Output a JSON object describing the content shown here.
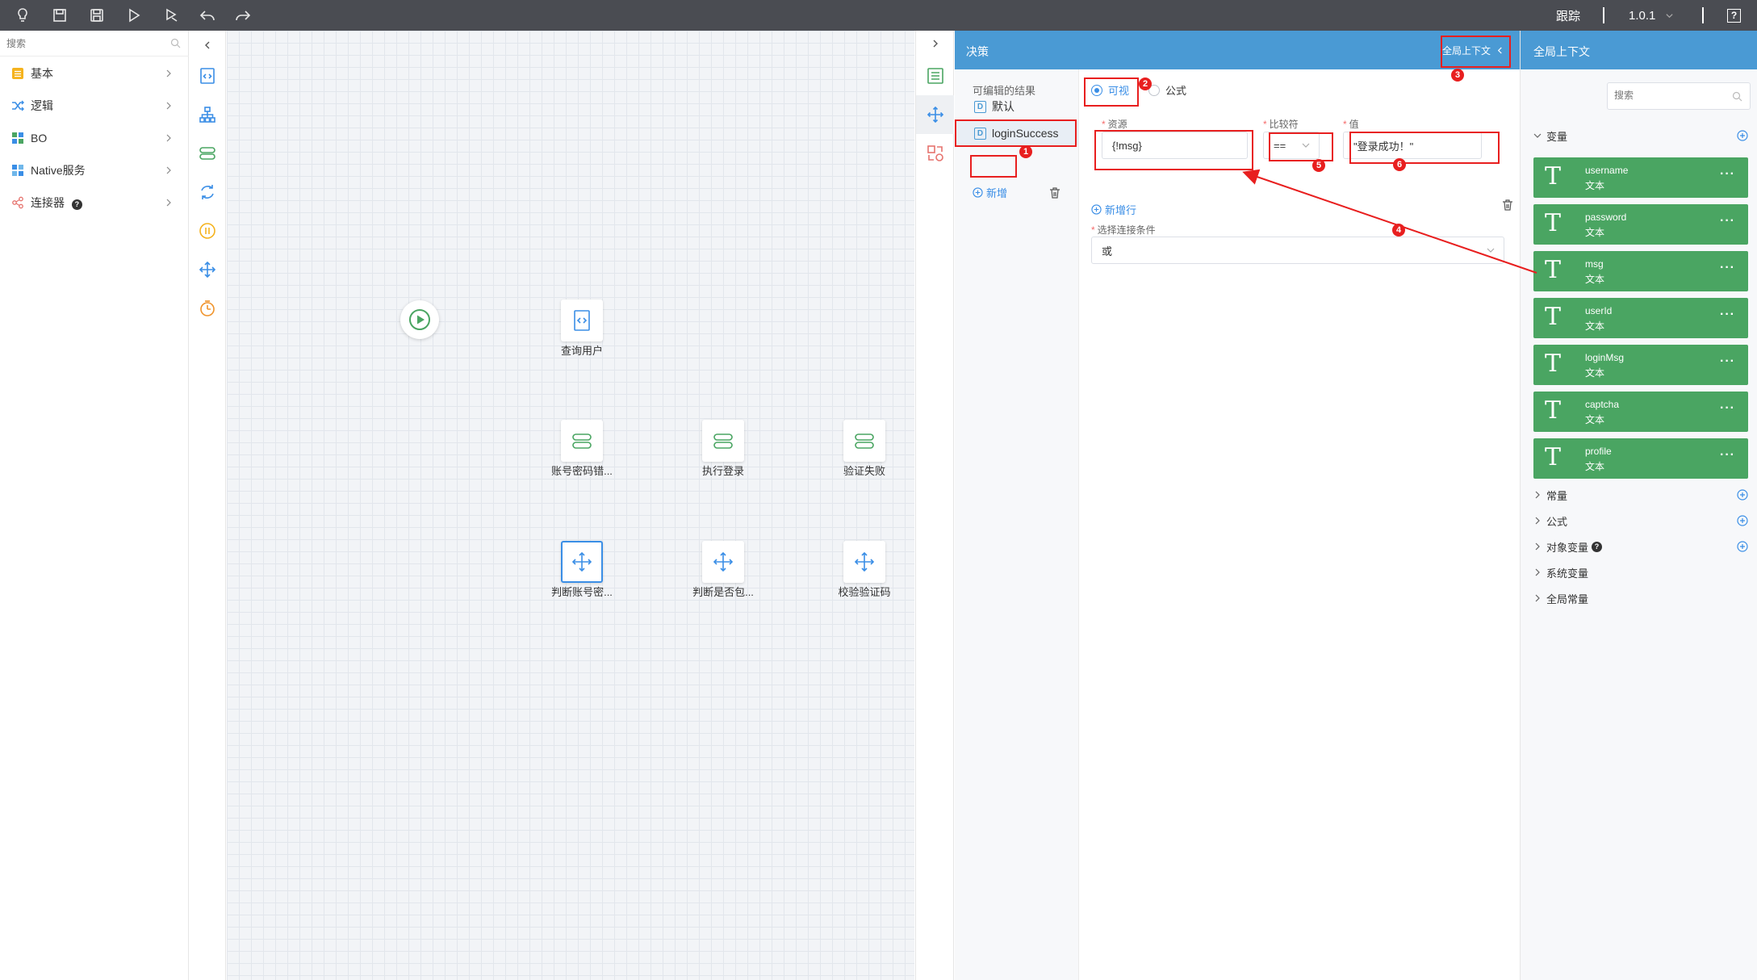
{
  "toolbar": {
    "icons": [
      "lightbulb-icon",
      "save-icon",
      "save-as-icon",
      "run-icon",
      "debug-icon",
      "undo-icon",
      "redo-icon"
    ],
    "trace_label": "跟踪",
    "version": "1.0.1",
    "help_label": "?"
  },
  "left_panel": {
    "search_placeholder": "搜索",
    "categories": [
      {
        "label": "基本",
        "icon": "basic-icon",
        "color": "#f5b31e"
      },
      {
        "label": "逻辑",
        "icon": "logic-shuffle-icon",
        "color": "#3a8ee6"
      },
      {
        "label": "BO",
        "icon": "bo-grid-icon",
        "color": "#4aa562"
      },
      {
        "label": "Native服务",
        "icon": "native-service-icon",
        "color": "#3a8ee6"
      },
      {
        "label": "连接器",
        "icon": "connector-icon",
        "color": "#e6736e",
        "help": "?"
      }
    ]
  },
  "vertical_tools": [
    "code-node-icon",
    "tree-node-icon",
    "storage-node-icon",
    "loop-node-icon",
    "pause-node-icon",
    "decision-node-icon",
    "timer-node-icon"
  ],
  "canvas": {
    "nodes": [
      {
        "label": "查询用户",
        "icon": "code-node-icon"
      },
      {
        "label": "账号密码错...",
        "icon": "storage-node-icon"
      },
      {
        "label": "执行登录",
        "icon": "storage-node-icon"
      },
      {
        "label": "验证失败",
        "icon": "storage-node-icon"
      },
      {
        "label": "判断账号密...",
        "icon": "decision-node-icon"
      },
      {
        "label": "判断是否包...",
        "icon": "decision-node-icon"
      },
      {
        "label": "校验验证码",
        "icon": "decision-node-icon"
      }
    ]
  },
  "right_tools": [
    "list-icon",
    "decision-move-icon",
    "shapes-icon"
  ],
  "decision": {
    "title": "决策",
    "global_context_link": "全局上下文",
    "results_title": "可编辑的结果",
    "results": [
      {
        "badge": "D",
        "label": "默认"
      },
      {
        "badge": "D",
        "label": "loginSuccess"
      }
    ],
    "add_label": "新增",
    "mode_options": [
      "可视",
      "公式"
    ],
    "selected_mode": "可视",
    "resource_label": "资源",
    "resource_value": "{!msg}",
    "operator_label": "比较符",
    "operator_value": "==",
    "value_label": "值",
    "value_value": "\"登录成功！\"",
    "add_row_label": "新增行",
    "condition_label": "选择连接条件",
    "condition_value": "或"
  },
  "context": {
    "title": "全局上下文",
    "search_placeholder": "搜索",
    "variables_label": "变量",
    "variables": [
      {
        "name": "username",
        "type": "文本"
      },
      {
        "name": "password",
        "type": "文本"
      },
      {
        "name": "msg",
        "type": "文本"
      },
      {
        "name": "userId",
        "type": "文本"
      },
      {
        "name": "loginMsg",
        "type": "文本"
      },
      {
        "name": "captcha",
        "type": "文本"
      },
      {
        "name": "profile",
        "type": "文本"
      }
    ],
    "var_glyph": "T",
    "var_more": "···",
    "sections": [
      "常量",
      "公式",
      "对象变量",
      "系统变量",
      "全局常量"
    ],
    "help": "?"
  },
  "annotations": [
    "1",
    "2",
    "3",
    "4",
    "5",
    "6"
  ],
  "colors": {
    "toolbar": "#4a4c52",
    "header_blue": "#4a9ad4",
    "variable_green": "#4aa562",
    "accent": "#3a8ee6",
    "annotation_red": "#e81f1f"
  }
}
